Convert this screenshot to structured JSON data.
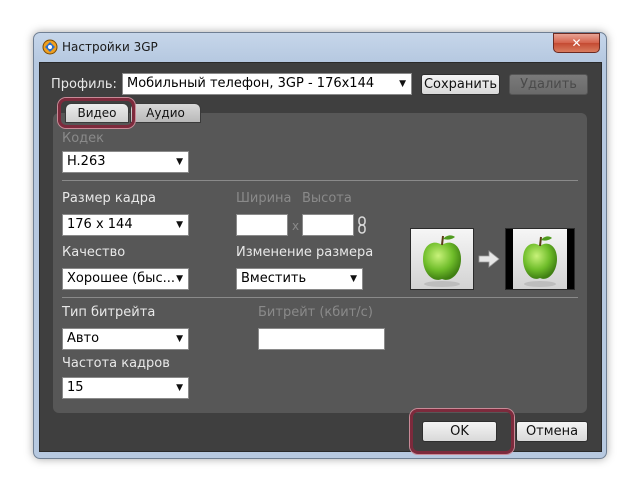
{
  "window": {
    "title": "Настройки 3GP",
    "close_glyph": "✕"
  },
  "profile": {
    "label": "Профиль:",
    "value": "Мобильный телефон, 3GP - 176x144",
    "save_label": "Сохранить",
    "delete_label": "Удалить"
  },
  "tabs": [
    {
      "label": "Видео",
      "active": true
    },
    {
      "label": "Аудио",
      "active": false
    }
  ],
  "video": {
    "codec": {
      "label": "Кодек",
      "value": "H.263"
    },
    "frame_size": {
      "label": "Размер кадра",
      "value": "176 x 144"
    },
    "width_label": "Ширина",
    "height_label": "Высота",
    "times": "x",
    "quality": {
      "label": "Качество",
      "value": "Хорошее (быс..."
    },
    "resize": {
      "label": "Изменение размера",
      "value": "Вместить"
    },
    "bitrate_type": {
      "label": "Тип битрейта",
      "value": "Авто"
    },
    "bitrate": {
      "label": "Битрейт (кбит/с)",
      "value": ""
    },
    "frame_rate": {
      "label": "Частота кадров",
      "value": "15"
    }
  },
  "footer": {
    "ok_label": "OK",
    "cancel_label": "Отмена"
  },
  "colors": {
    "client_bg": "#3f3f3f",
    "panel_bg": "#575757",
    "highlight": "#7d2a3c",
    "apple_green": "#6fbd2a"
  }
}
